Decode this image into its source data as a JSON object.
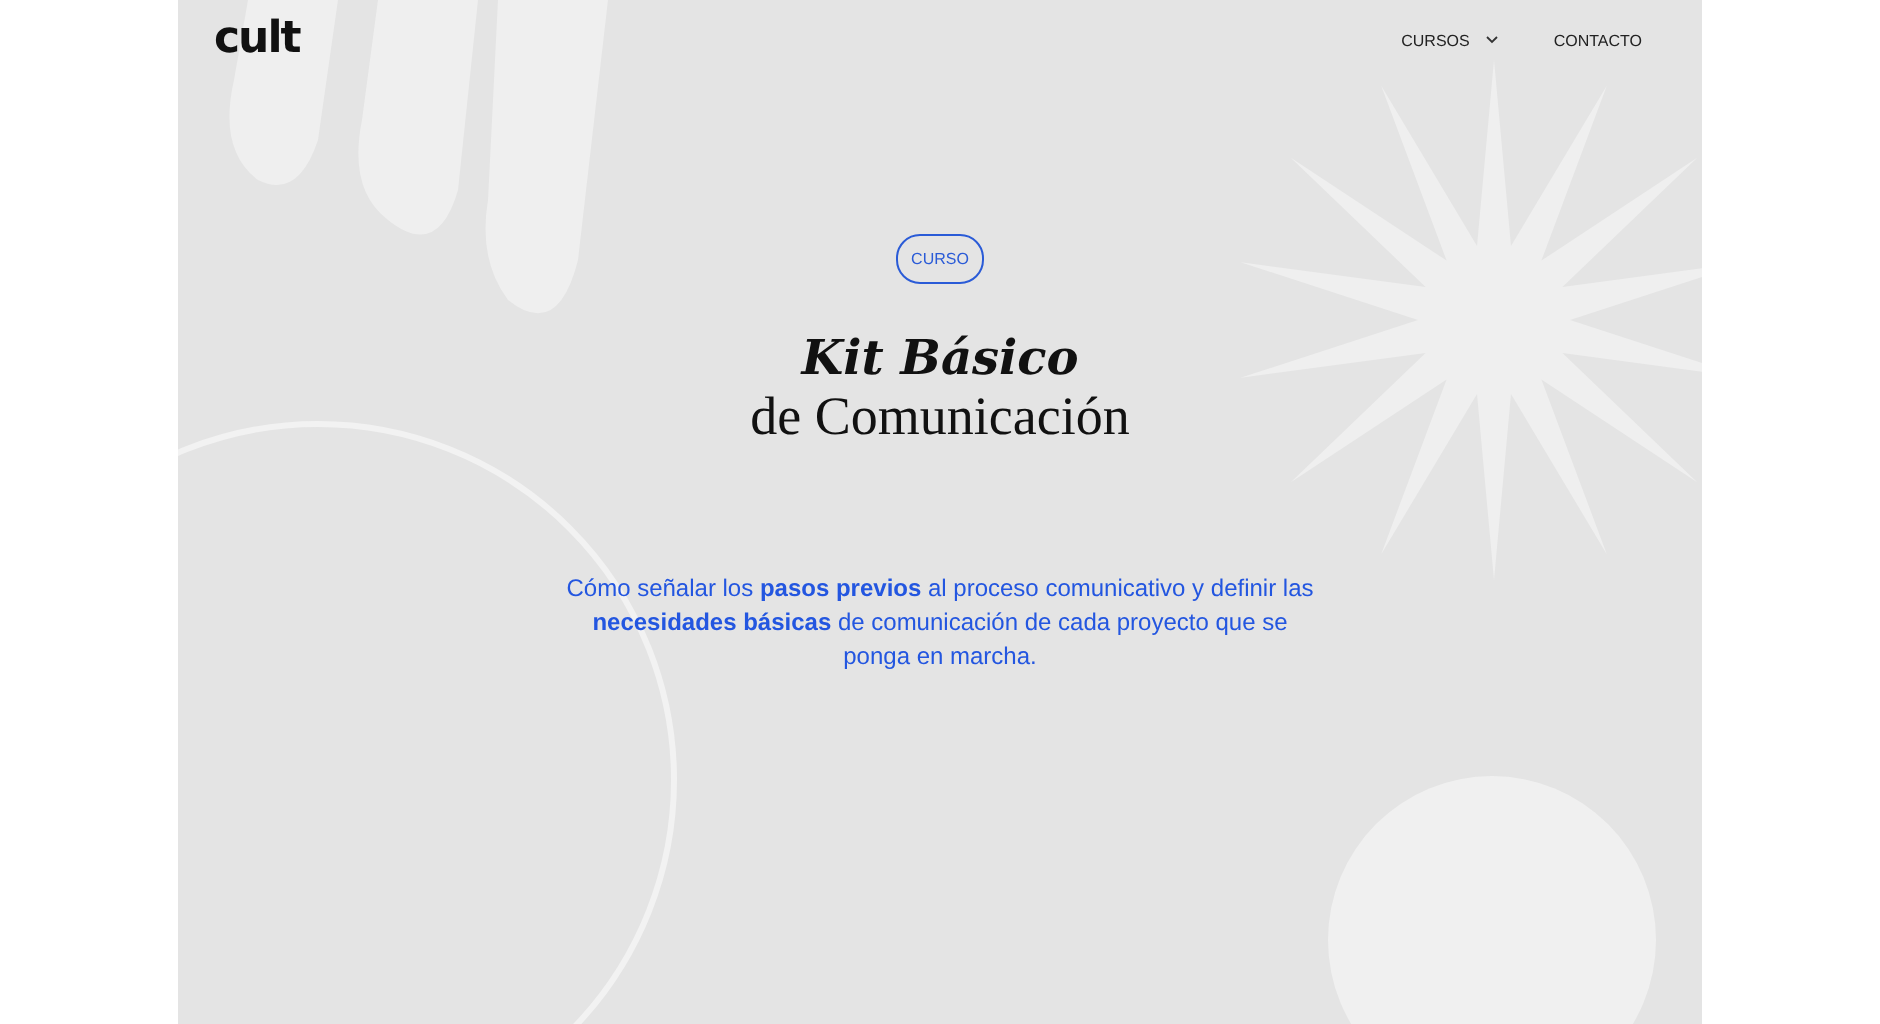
{
  "header": {
    "logo": "cult",
    "nav": [
      {
        "label": "CURSOS",
        "kind": "dropdown"
      },
      {
        "label": "CONTACTO",
        "kind": "link"
      }
    ]
  },
  "hero": {
    "badge": "CURSO",
    "title_emphasis": "Kit Básico",
    "title_rest": "de Comunicación",
    "description": "Cómo señalar los **pasos previos** al proceso comunicativo y definir las **necesidades básicas** de comunicación de cada proyecto que se ponga en marcha."
  }
}
